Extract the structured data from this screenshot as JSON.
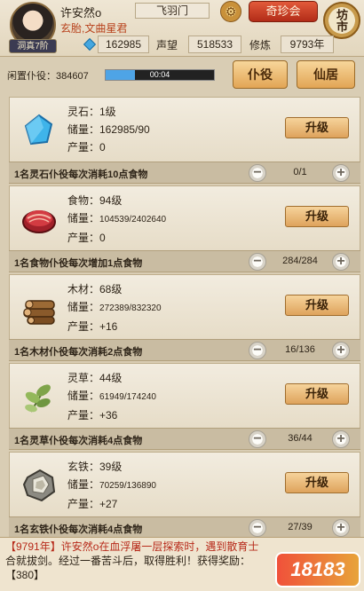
{
  "header": {
    "player_name": "许安然o",
    "sect": "飞羽门",
    "treasure_button": "奇珍会",
    "market_button": "坊市",
    "title": "玄胎,文曲星君",
    "realm": "洞真7阶",
    "spirit_stone": "162985",
    "reputation_label": "声望",
    "reputation": "518533",
    "cultivation_label": "修炼",
    "cultivation": "9793年"
  },
  "idle": {
    "label": "闲置仆役：384607",
    "timer": "00:04",
    "progress": 0.27
  },
  "tabs": [
    {
      "label": "仆役"
    },
    {
      "label": "仙居"
    }
  ],
  "resources": [
    {
      "name": "灵石：1级",
      "storage": "储量：162985/90",
      "output": "产量：0",
      "upgrade": "升级",
      "icon": "spirit-stone-icon",
      "worker_desc": "1名灵石仆役每次消耗10点食物",
      "worker_count": "0/1"
    },
    {
      "name": "食物：94级",
      "storage_label": "储量：",
      "storage_value": "104539/2402640",
      "output": "产量：0",
      "upgrade": "升级",
      "icon": "meat-icon",
      "worker_desc": "1名食物仆役每次增加1点食物",
      "worker_count": "284/284"
    },
    {
      "name": "木材：68级",
      "storage_label": "储量：",
      "storage_value": "272389/832320",
      "output": "产量：+16",
      "upgrade": "升级",
      "icon": "wood-icon",
      "worker_desc": "1名木材仆役每次消耗2点食物",
      "worker_count": "16/136"
    },
    {
      "name": "灵草：44级",
      "storage_label": "储量：",
      "storage_value": "61949/174240",
      "output": "产量：+36",
      "upgrade": "升级",
      "icon": "herb-icon",
      "worker_desc": "1名灵草仆役每次消耗4点食物",
      "worker_count": "36/44"
    },
    {
      "name": "玄铁：39级",
      "storage_label": "储量：",
      "storage_value": "70259/136890",
      "output": "产量：+27",
      "upgrade": "升级",
      "icon": "iron-ore-icon",
      "worker_desc": "1名玄铁仆役每次消耗4点食物",
      "worker_count": "27/39"
    }
  ],
  "log": {
    "line1": "【9791年】许安然o在血浮屠一层探索时，遇到散育士",
    "line2": "合就拔剑。经过一番苦斗后，取得胜利！获得奖励：",
    "line3": "【380】"
  },
  "watermark": "18183"
}
